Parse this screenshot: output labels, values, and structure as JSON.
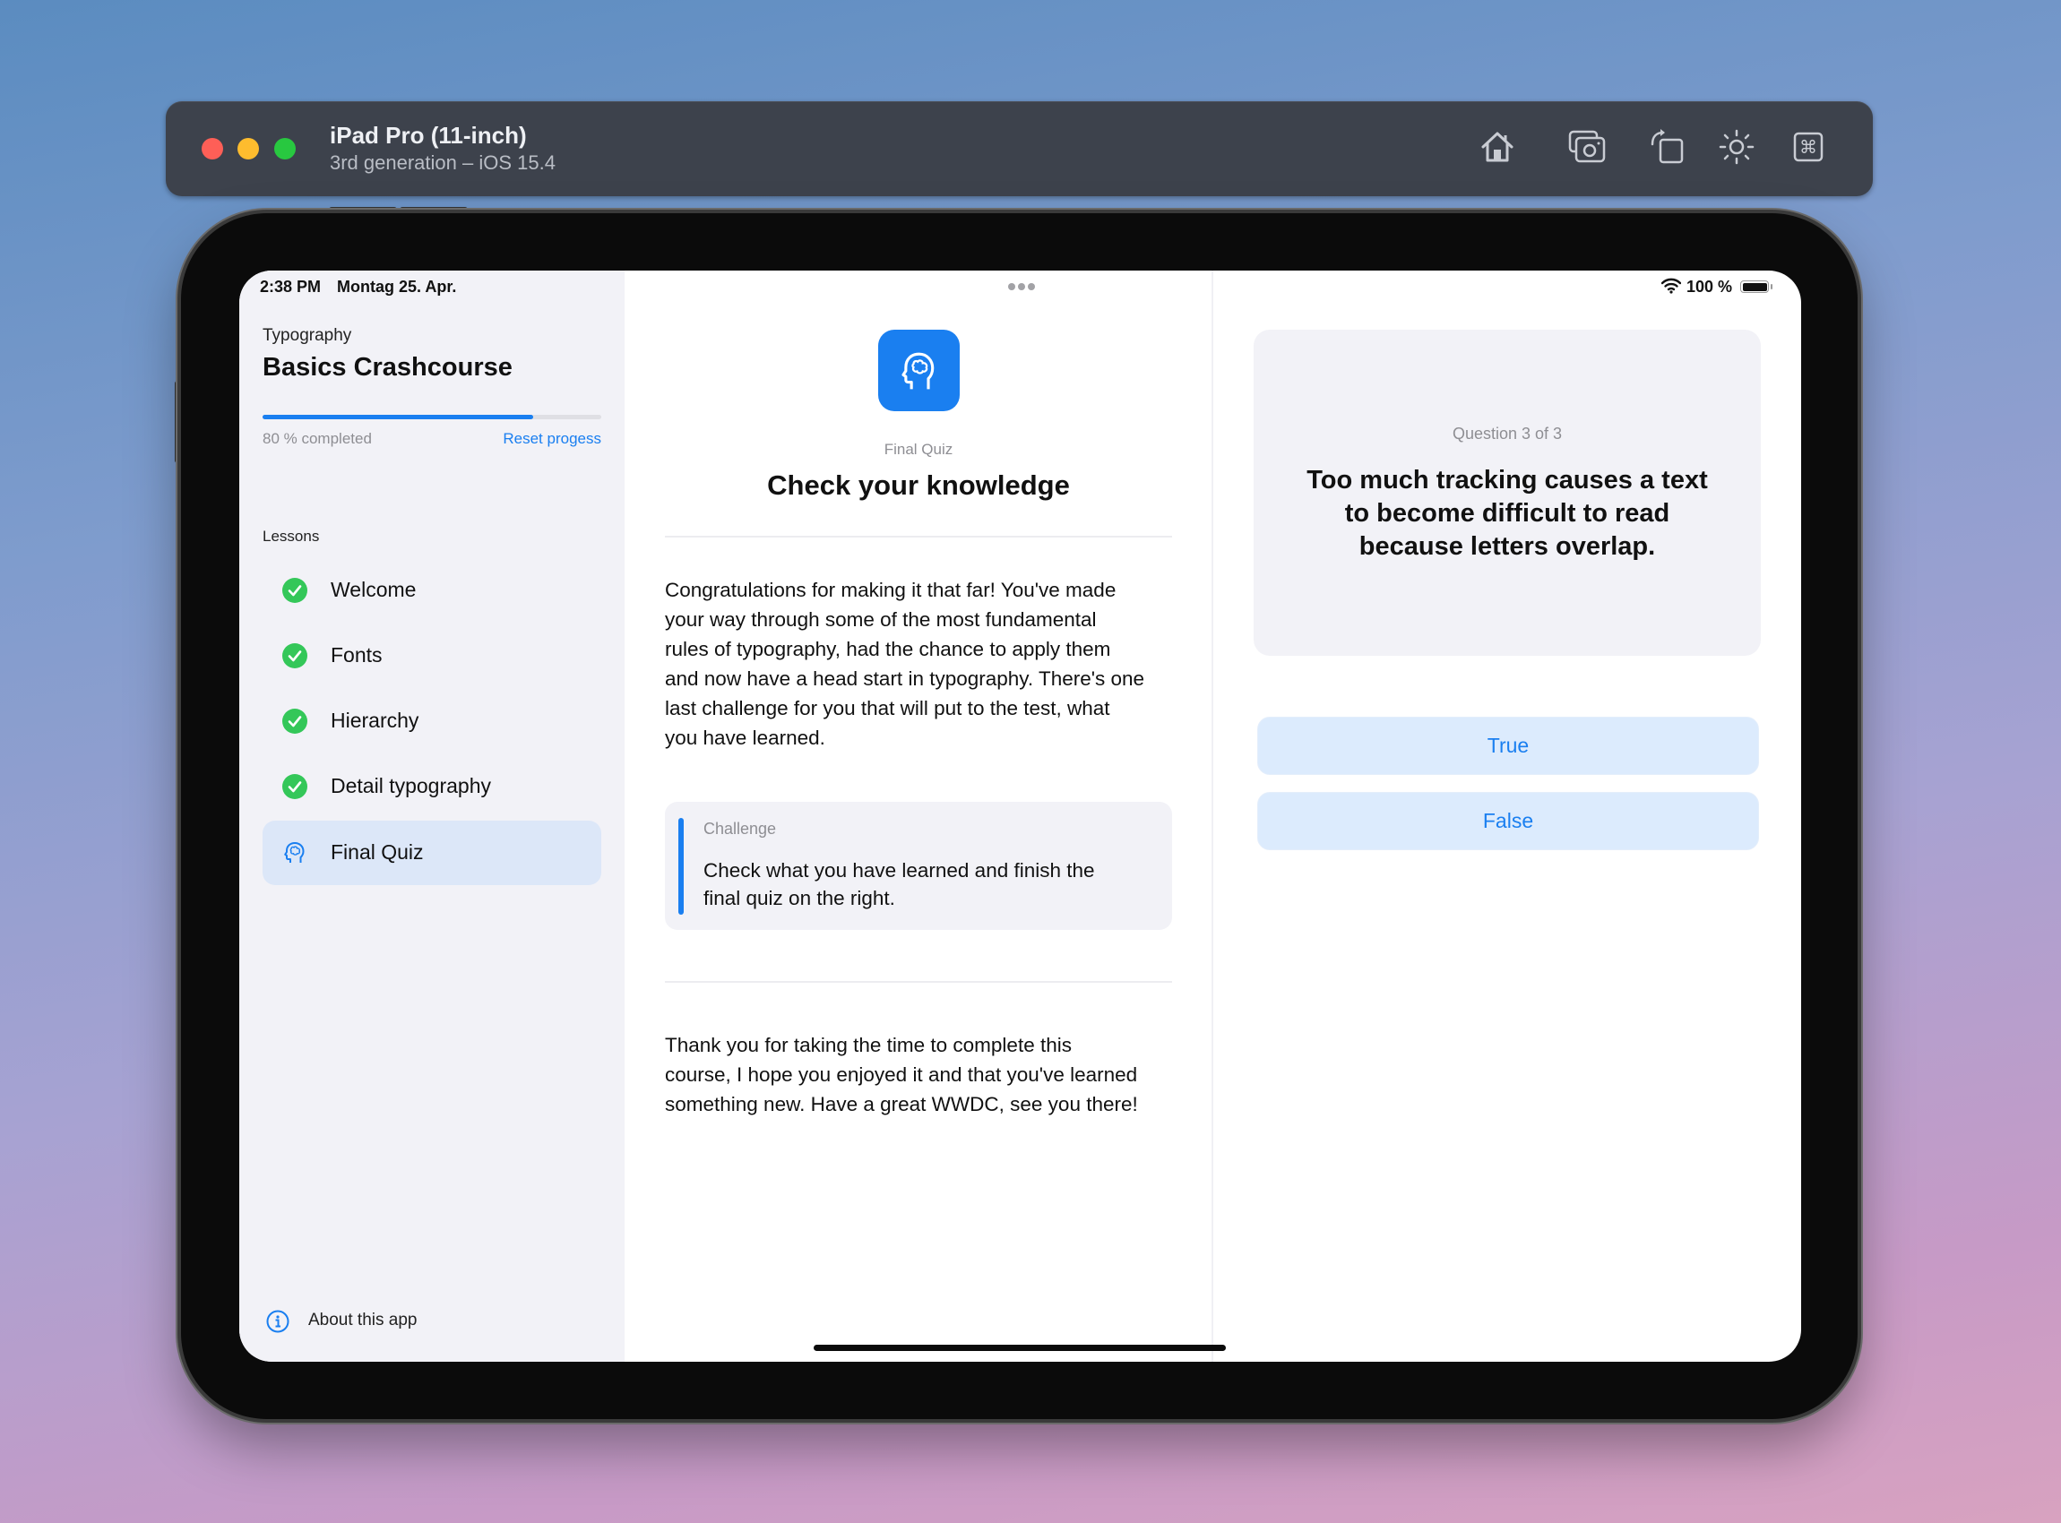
{
  "window": {
    "title": "iPad Pro (11-inch)",
    "subtitle": "3rd generation – iOS 15.4",
    "traffic_lights": {
      "close": "#fe5f57",
      "minimize": "#febc2e",
      "zoom": "#28c840"
    },
    "toolbar_icons": [
      "home-icon",
      "screenshot-icon",
      "rotate-icon",
      "appearance-icon",
      "command-icon"
    ]
  },
  "status_bar": {
    "time": "2:38 PM",
    "date": "Montag 25. Apr.",
    "battery": "100 %"
  },
  "sidebar": {
    "subtitle": "Typography",
    "title": "Basics Crashcourse",
    "progress": 0.8,
    "progress_label": "80 % completed",
    "reset_label": "Reset progess",
    "lessons_header": "Lessons",
    "lessons": [
      {
        "label": "Welcome",
        "icon": "checkmark-circle-icon",
        "completed": true
      },
      {
        "label": "Fonts",
        "icon": "checkmark-circle-icon",
        "completed": true
      },
      {
        "label": "Hierarchy",
        "icon": "checkmark-circle-icon",
        "completed": true
      },
      {
        "label": "Detail typography",
        "icon": "checkmark-circle-icon",
        "completed": true
      },
      {
        "label": "Final Quiz",
        "icon": "brain-head-icon",
        "selected": true
      }
    ],
    "about_label": "About this app"
  },
  "content": {
    "eyebrow": "Final Quiz",
    "title": "Check your knowledge",
    "intro_lines": [
      "Congratulations for making it that far! You've made",
      "your way through some of the most fundamental",
      "rules of typography, had the chance to apply them",
      "and now have a head start in typography. There's one",
      "last challenge for you that will put to the test, what",
      "you have learned."
    ],
    "challenge": {
      "label": "Challenge",
      "lines": [
        "Check what you have learned and finish the",
        "final quiz on the right."
      ]
    },
    "outro_lines": [
      "Thank you for taking the time to complete this",
      "course, I hope you enjoyed it and that you've learned",
      "something new. Have a great WWDC, see you there!"
    ]
  },
  "quiz": {
    "counter": "Question 3 of 3",
    "question_lines": [
      "Too much tracking causes a text",
      "to become difficult to read",
      "because letters overlap."
    ],
    "answers": [
      "True",
      "False"
    ]
  },
  "colors": {
    "accent": "#1a7ff0",
    "success": "#34c759",
    "sidebar_bg": "#f2f2f7",
    "selected_bg": "#dce7f8",
    "answer_bg": "#dcebfd"
  }
}
